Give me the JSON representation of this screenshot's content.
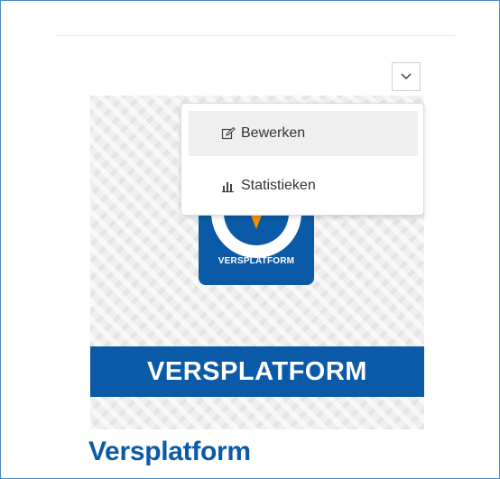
{
  "card": {
    "title": "Versplatform",
    "image": {
      "logo_text": "VERSPLATFORM",
      "banner_text": "VERSPLATFORM"
    }
  },
  "menu": {
    "items": [
      {
        "label": "Bewerken",
        "icon": "edit-icon"
      },
      {
        "label": "Statistieken",
        "icon": "bar-chart-icon"
      }
    ]
  },
  "colors": {
    "brand_blue": "#0b5aa7",
    "accent_orange": "#f39200",
    "frame_border": "#4a86c8"
  }
}
